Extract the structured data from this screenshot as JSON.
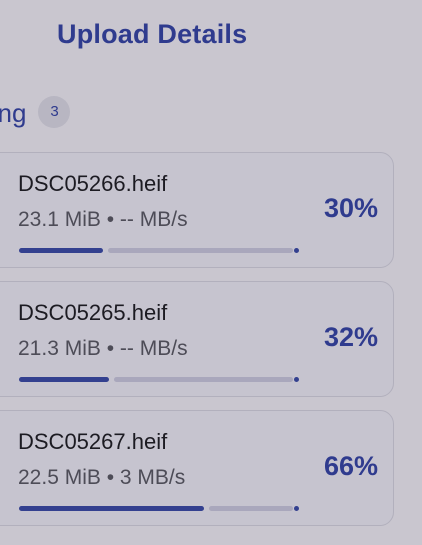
{
  "header": {
    "title": "Upload Details"
  },
  "section": {
    "label": "ling",
    "count": "3"
  },
  "uploads": [
    {
      "filename": "DSC05266.heif",
      "size": "23.1 MiB",
      "separator": "•",
      "speed": "-- MB/s",
      "percent_label": "30%",
      "progress": 0.3
    },
    {
      "filename": "DSC05265.heif",
      "size": "21.3 MiB",
      "separator": "•",
      "speed": "-- MB/s",
      "percent_label": "32%",
      "progress": 0.32
    },
    {
      "filename": "DSC05267.heif",
      "size": "22.5 MiB",
      "separator": "•",
      "speed": "3 MB/s",
      "percent_label": "66%",
      "progress": 0.66
    }
  ],
  "colors": {
    "accent": "#2f3b8e",
    "progress_fill": "#33408f",
    "progress_track": "#a9a7bc",
    "background": "#c9c6cf",
    "card_background": "#c6c4cf",
    "card_border": "#b2b0bd"
  }
}
